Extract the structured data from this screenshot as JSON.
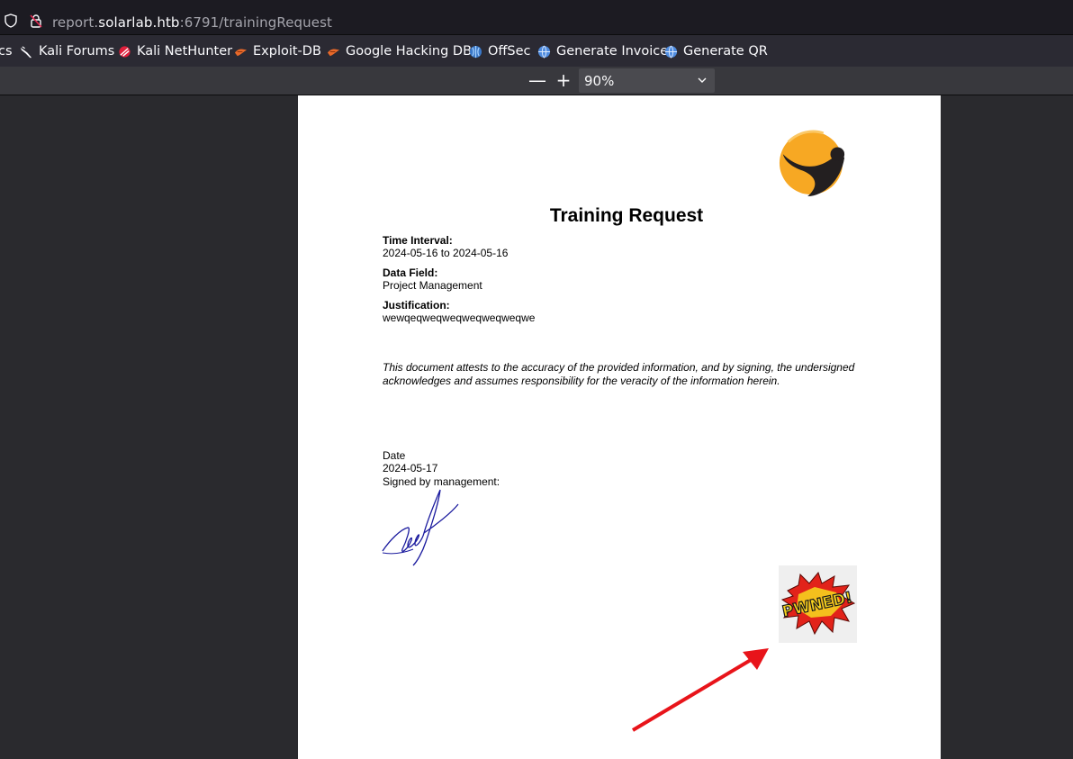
{
  "browser": {
    "url_prefix": "report.",
    "url_host": "solarlab.htb",
    "url_path": ":6791/trainingRequest"
  },
  "bookmarks": [
    {
      "label": "cs",
      "icon": "hidden-icon"
    },
    {
      "label": "Kali Forums",
      "icon": "kali-dragon-icon"
    },
    {
      "label": "Kali NetHunter",
      "icon": "nethunter-icon"
    },
    {
      "label": "Exploit-DB",
      "icon": "exploitdb-icon"
    },
    {
      "label": "Google Hacking DB",
      "icon": "ghdb-icon"
    },
    {
      "label": "OffSec",
      "icon": "offsec-icon"
    },
    {
      "label": "Generate Invoice",
      "icon": "globe-icon"
    },
    {
      "label": "Generate QR",
      "icon": "globe-icon"
    }
  ],
  "pdf_toolbar": {
    "zoom_out": "—",
    "zoom_in": "+",
    "zoom_value": "90%"
  },
  "document": {
    "title": "Training Request",
    "time_interval_label": "Time Interval:",
    "time_interval_value": "2024-05-16 to 2024-05-16",
    "data_field_label": "Data Field:",
    "data_field_value": "Project Management",
    "justification_label": "Justification:",
    "justification_value": "wewqeqweqweqweqweqweqwe",
    "attestation": "This document attests to the accuracy of the provided information, and by signing, the undersigned acknowledges and assumes responsibility for the veracity of the information herein.",
    "date_label": "Date",
    "date_value": "2024-05-17",
    "signed_label": "Signed by management:",
    "pwned_text": "PWNED!"
  },
  "colors": {
    "logo_orange": "#f7a823",
    "logo_dark": "#231f20",
    "arrow_red": "#e8141a",
    "signature_blue": "#1a1a9e"
  }
}
